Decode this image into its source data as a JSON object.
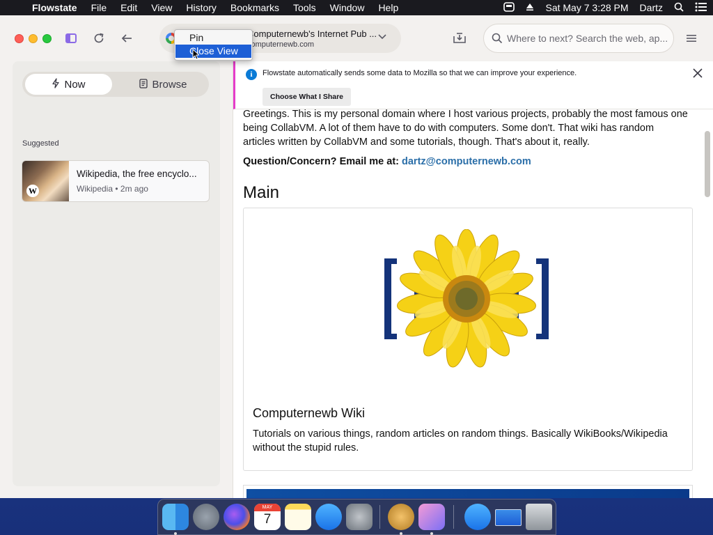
{
  "menubar": {
    "app_name": "Flowstate",
    "items": [
      "File",
      "Edit",
      "View",
      "History",
      "Bookmarks",
      "Tools",
      "Window",
      "Help"
    ],
    "datetime": "Sat May 7  3:28 PM",
    "user": "Dartz"
  },
  "toolbar": {
    "tab_title": "Computernewb's Internet Pub ...",
    "tab_domain": "computernewb.com",
    "search_placeholder": "Where to next? Search the web, ap..."
  },
  "context_menu": {
    "items": [
      "Pin",
      "Close View"
    ],
    "highlighted": "Close View"
  },
  "sidebar": {
    "tabs": [
      "Now",
      "Browse"
    ],
    "active_tab": "Now",
    "section_label": "Suggested",
    "suggestion": {
      "title": "Wikipedia, the free encyclo...",
      "source": "Wikipedia",
      "age": "2m ago"
    }
  },
  "notification": {
    "text": "Flowstate automatically sends some data to Mozilla so that we can improve your experience.",
    "button": "Choose What I Share"
  },
  "page": {
    "intro": "Greetings. This is my personal domain where I host various projects, probably the most famous one being CollabVM. A lot of them have to do with computers. Some don't. That wiki has random articles written by CollabVM and some tutorials, though. That's about it, really.",
    "contact_label": "Question/Concern? Email me at: ",
    "contact_email": "dartz@computernewb.com",
    "heading": "Main",
    "wiki_title": "Computernewb Wiki",
    "wiki_desc": "Tutorials on various things, random articles on random things. Basically WikiBooks/Wikipedia without the stupid rules."
  },
  "colors": {
    "menubar_bg": "#1a1a1f",
    "highlight": "#1d5fd6",
    "link": "#2a6ea8",
    "notification_accent": "#e53cc9"
  },
  "dock": {
    "apps": [
      "finder-icon",
      "launchpad-icon",
      "firefox-icon",
      "calendar-icon",
      "notes-icon",
      "app-store-icon",
      "system-preferences-icon",
      "keychain-icon",
      "flowstate-icon",
      "app-store-downloads-icon",
      "screen-icon",
      "trash-icon"
    ],
    "calendar_month": "MAY",
    "calendar_day": "7"
  }
}
